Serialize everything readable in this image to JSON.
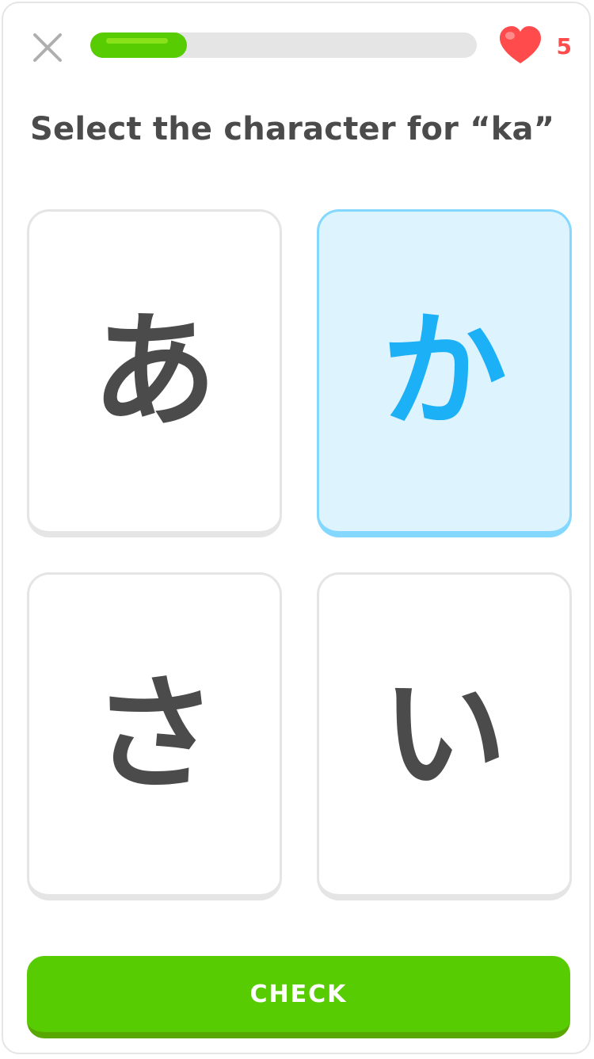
{
  "header": {
    "close_icon": "close-icon",
    "progress": 0.25,
    "hearts": {
      "icon": "heart-icon",
      "count": "5",
      "color": "#ff4b4b"
    }
  },
  "question": {
    "title": "Select the character for “ka”"
  },
  "choices": [
    {
      "char": "あ",
      "selected": false
    },
    {
      "char": "か",
      "selected": true
    },
    {
      "char": "さ",
      "selected": false
    },
    {
      "char": "い",
      "selected": false
    }
  ],
  "footer": {
    "check_label": "CHECK"
  },
  "colors": {
    "primary_green": "#58cc02",
    "green_shadow": "#58a700",
    "green_highlight": "#89e219",
    "selected_blue": "#1cb0f6",
    "selected_border": "#84d8ff",
    "selected_bg": "#ddf4ff",
    "text": "#4b4b4b",
    "border": "#e5e5e5"
  }
}
